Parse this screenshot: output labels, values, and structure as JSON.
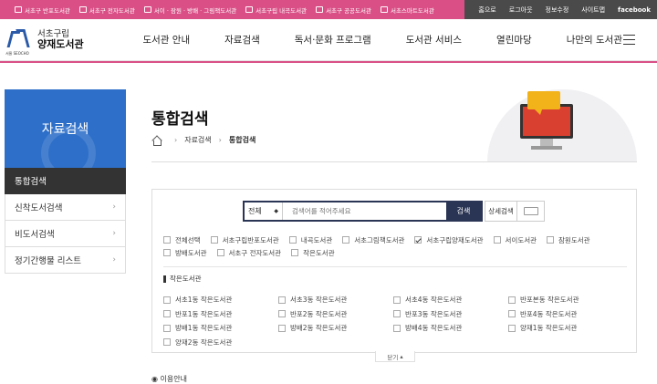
{
  "top_links": [
    {
      "label": "서초구 반포도서관",
      "icon": "library-icon"
    },
    {
      "label": "서초구 전자도서관",
      "icon": "ebook-icon"
    },
    {
      "label": "서이 · 잠원 · 방배 · 그림책도서관",
      "icon": "library-icon"
    },
    {
      "label": "서초구립 내곡도서관",
      "icon": "library-icon"
    },
    {
      "label": "서초구 공공도서관",
      "icon": "library-icon"
    },
    {
      "label": "서초스마트도서관",
      "icon": "smart-library-icon"
    }
  ],
  "util_links": [
    "홈으로",
    "로그아웃",
    "정보수정",
    "사이트맵",
    "facebook"
  ],
  "logo": {
    "line1": "서초구립",
    "line2": "양재도서관",
    "sub": "서울 SEOCHO"
  },
  "nav": [
    "도서관 안내",
    "자료검색",
    "독서·문화 프로그램",
    "도서관 서비스",
    "열린마당",
    "나만의 도서관"
  ],
  "sidebar": {
    "banner_title": "자료검색",
    "items": [
      {
        "label": "통합검색",
        "active": true
      },
      {
        "label": "신착도서검색",
        "active": false
      },
      {
        "label": "비도서검색",
        "active": false
      },
      {
        "label": "정기간행물 리스트",
        "active": false
      }
    ]
  },
  "page": {
    "title": "통합검색"
  },
  "breadcrumb": {
    "level1": "자료검색",
    "level2": "통합검색"
  },
  "search": {
    "select_value": "전체",
    "placeholder": "검색어를 적어주세요",
    "button": "검색",
    "detail_button": "상세검색"
  },
  "libraries": [
    {
      "label": "전체선택",
      "checked": false
    },
    {
      "label": "서초구립반포도서관",
      "checked": false
    },
    {
      "label": "내곡도서관",
      "checked": false
    },
    {
      "label": "서초그림책도서관",
      "checked": false
    },
    {
      "label": "서초구립양재도서관",
      "checked": true
    },
    {
      "label": "서이도서관",
      "checked": false
    },
    {
      "label": "잠원도서관",
      "checked": false
    },
    {
      "label": "방배도서관",
      "checked": false
    },
    {
      "label": "서초구 전자도서관",
      "checked": false
    },
    {
      "label": "작은도서관",
      "checked": false
    }
  ],
  "small_section_title": "작은도서관",
  "small_libraries": [
    "서초1동 작은도서관",
    "서초3동 작은도서관",
    "서초4동 작은도서관",
    "반포본동 작은도서관",
    "반포1동 작은도서관",
    "반포2동 작은도서관",
    "반포3동 작은도서관",
    "반포4동 작은도서관",
    "방배1동 작은도서관",
    "방배2동 작은도서관",
    "방배4동 작은도서관",
    "양재1동 작은도서관",
    "양재2동 작은도서관"
  ],
  "close_label": "닫기",
  "footer_hint": "이용안내",
  "colors": {
    "brand_pink": "#d94f86",
    "navy": "#2a3454",
    "side_blue": "#2d6fc9"
  }
}
